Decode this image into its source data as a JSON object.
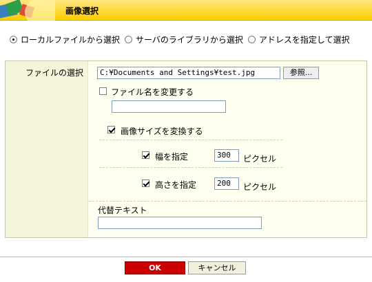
{
  "header": {
    "title": "画像選択"
  },
  "source": {
    "options": [
      {
        "label": "ローカルファイルから選択",
        "checked": true
      },
      {
        "label": "サーバのライブラリから選択",
        "checked": false
      },
      {
        "label": "アドレスを指定して選択",
        "checked": false
      }
    ]
  },
  "form": {
    "file_label": "ファイルの選択",
    "file_value": "C:¥Documents and Settings¥test.jpg",
    "browse_label": "参照...",
    "rename_label": "ファイル名を変更する",
    "rename_value": "",
    "rename_checked": false,
    "resize_label": "画像サイズを変換する",
    "resize_checked": true,
    "width_label": "幅を指定",
    "width_value": "300",
    "width_unit": "ピクセル",
    "width_checked": true,
    "height_label": "高さを指定",
    "height_value": "200",
    "height_unit": "ピクセル",
    "height_checked": true,
    "alt_label": "代替テキスト",
    "alt_value": ""
  },
  "buttons": {
    "ok": "OK",
    "cancel": "キャンセル"
  },
  "colors": {
    "header_bg": "#ffcc00",
    "panel_bg": "#fffff0",
    "ok_bg": "#cc0000"
  }
}
